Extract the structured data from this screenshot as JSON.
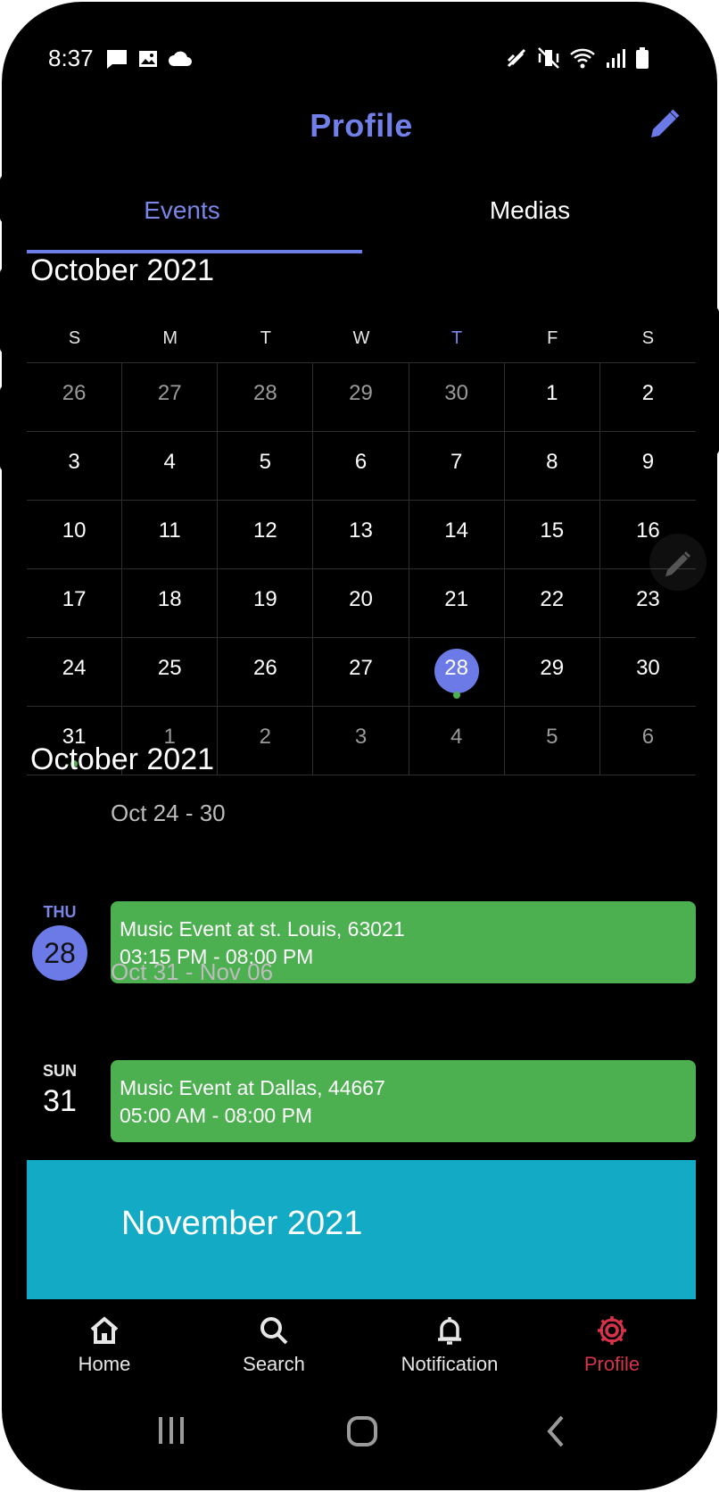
{
  "status_bar": {
    "time": "8:37",
    "left_icons": [
      "message-icon",
      "image-icon",
      "cloud-icon"
    ],
    "right_icons": [
      "nfc-icon",
      "vibrate-mute-icon",
      "wifi-icon",
      "signal-icon",
      "battery-icon"
    ]
  },
  "header": {
    "title": "Profile",
    "edit_icon": "pencil-icon"
  },
  "tabs": [
    {
      "label": "Events",
      "active": true
    },
    {
      "label": "Medias",
      "active": false
    }
  ],
  "calendar": {
    "month_title": "October 2021",
    "weekdays": [
      "S",
      "M",
      "T",
      "W",
      "T",
      "F",
      "S"
    ],
    "today_weekday_index": 4,
    "weeks": [
      [
        {
          "d": "26",
          "muted": true
        },
        {
          "d": "27",
          "muted": true
        },
        {
          "d": "28",
          "muted": true
        },
        {
          "d": "29",
          "muted": true
        },
        {
          "d": "30",
          "muted": true
        },
        {
          "d": "1"
        },
        {
          "d": "2"
        }
      ],
      [
        {
          "d": "3"
        },
        {
          "d": "4"
        },
        {
          "d": "5"
        },
        {
          "d": "6"
        },
        {
          "d": "7"
        },
        {
          "d": "8"
        },
        {
          "d": "9"
        }
      ],
      [
        {
          "d": "10"
        },
        {
          "d": "11"
        },
        {
          "d": "12"
        },
        {
          "d": "13"
        },
        {
          "d": "14"
        },
        {
          "d": "15"
        },
        {
          "d": "16"
        }
      ],
      [
        {
          "d": "17"
        },
        {
          "d": "18"
        },
        {
          "d": "19"
        },
        {
          "d": "20"
        },
        {
          "d": "21"
        },
        {
          "d": "22"
        },
        {
          "d": "23"
        }
      ],
      [
        {
          "d": "24"
        },
        {
          "d": "25"
        },
        {
          "d": "26"
        },
        {
          "d": "27"
        },
        {
          "d": "28",
          "selected": true,
          "event": true
        },
        {
          "d": "29"
        },
        {
          "d": "30"
        }
      ],
      [
        {
          "d": "31",
          "event": true
        },
        {
          "d": "1",
          "muted": true
        },
        {
          "d": "2",
          "muted": true
        },
        {
          "d": "3",
          "muted": true
        },
        {
          "d": "4",
          "muted": true
        },
        {
          "d": "5",
          "muted": true
        },
        {
          "d": "6",
          "muted": true
        }
      ]
    ]
  },
  "schedule": {
    "month_title": "October 2021",
    "weeks": [
      {
        "range": "Oct 24 - 30",
        "day_abbr": "THU",
        "day_num": "28",
        "highlighted": true,
        "event": {
          "title": "Music Event at st. Louis, 63021",
          "time": "03:15 PM - 08:00 PM"
        }
      },
      {
        "range": "Oct 31 - Nov 06",
        "day_abbr": "SUN",
        "day_num": "31",
        "highlighted": false,
        "event": {
          "title": "Music Event at Dallas, 44667",
          "time": "05:00 AM - 08:00 PM"
        }
      }
    ],
    "next_month_banner": "November 2021"
  },
  "bottom_nav": [
    {
      "label": "Home",
      "icon": "home-icon",
      "active": false
    },
    {
      "label": "Search",
      "icon": "search-icon",
      "active": false
    },
    {
      "label": "Notification",
      "icon": "bell-icon",
      "active": false
    },
    {
      "label": "Profile",
      "icon": "gear-icon",
      "active": true
    }
  ],
  "colors": {
    "accent": "#6b7ae6",
    "event_green": "#4caf50",
    "banner_teal": "#12aac4",
    "active_nav": "#d6334b",
    "background": "#000000"
  }
}
